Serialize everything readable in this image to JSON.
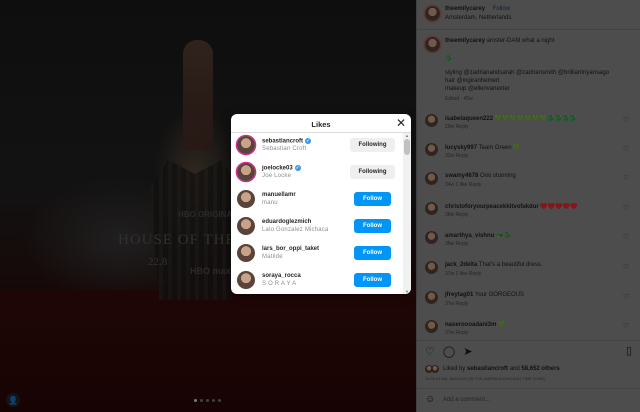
{
  "post": {
    "author": "theemilycarey",
    "follow_label": "Follow",
    "location": "Amsterdam, Netherlands",
    "caption_author": "theemilycarey",
    "caption_text": "amster-DAM what a night",
    "caption_line2": "🐉",
    "styling": "styling @zadrianandsarah @zadriansmith @brilliantnyansago",
    "hair": "hair @ingiranhemert",
    "makeup": "makeup @ellenvanexter",
    "caption_meta": "Edited · 45w",
    "photo_title": "HOUSE OF THE DRAGON",
    "photo_date": "22.8",
    "photo_brand": "HBO ORIGINAL",
    "photo_brand2": "HBO max"
  },
  "comments": [
    {
      "user": "isabelaqueen222",
      "text": "💚💚💚💚💚💚💚🐉🐉🐉🐉",
      "meta": "29w  Reply"
    },
    {
      "user": "lucysky997",
      "text": "Team Green 💚",
      "meta": "32w  Reply"
    },
    {
      "user": "swamy4678",
      "text": "Ooo stunning",
      "meta": "34w  1 like  Reply"
    },
    {
      "user": "christoforyourpeacekkitvofakdur",
      "text": "♥️♥️♥️♥️♥️",
      "meta": "36w  Reply"
    },
    {
      "user": "amarthya_vishnu",
      "text": "🐲🐉",
      "meta": "36w  Reply"
    },
    {
      "user": "jack_2delta",
      "text": "That's a beautiful dress.",
      "meta": "37w  1 like  Reply"
    },
    {
      "user": "jfreytag01",
      "text": "Your GORGEOUS",
      "meta": "37w  Reply"
    },
    {
      "user": "naseroooadani3m",
      "text": "💚",
      "meta": "37w  Reply"
    }
  ],
  "likes_summary": {
    "prefix": "Liked by",
    "user": "sebastiancroft",
    "suffix": "and",
    "others": "58,652 others",
    "date": "11:06 AT AM, 8/11/2022 (IN THE AMERICA/CHICAGO TIME ZONE)"
  },
  "comment_placeholder": "Add a comment...",
  "modal": {
    "title": "Likes",
    "close_icon": "✕",
    "rows": [
      {
        "username": "sebastiancroft",
        "fullname": "Sebastian Croft",
        "verified": true,
        "button": "Following",
        "state": "following",
        "story": true
      },
      {
        "username": "joelocke03",
        "fullname": "Joe Locke",
        "verified": true,
        "button": "Following",
        "state": "following",
        "story": true
      },
      {
        "username": "manuellamr",
        "fullname": "manu",
        "verified": false,
        "button": "Follow",
        "state": "follow",
        "story": false
      },
      {
        "username": "eduardoglezmich",
        "fullname": "Lalo Gonzalez Michaca",
        "verified": false,
        "button": "Follow",
        "state": "follow",
        "story": false
      },
      {
        "username": "lars_bor_oppi_taket",
        "fullname": "Matilde",
        "verified": false,
        "button": "Follow",
        "state": "follow",
        "story": false
      },
      {
        "username": "soraya_rocca",
        "fullname": "S O R A Y A",
        "verified": false,
        "button": "Follow",
        "state": "follow",
        "story": false
      }
    ]
  },
  "colors": {
    "follow_blue": "#0095f6",
    "verified": "#3897f0"
  }
}
